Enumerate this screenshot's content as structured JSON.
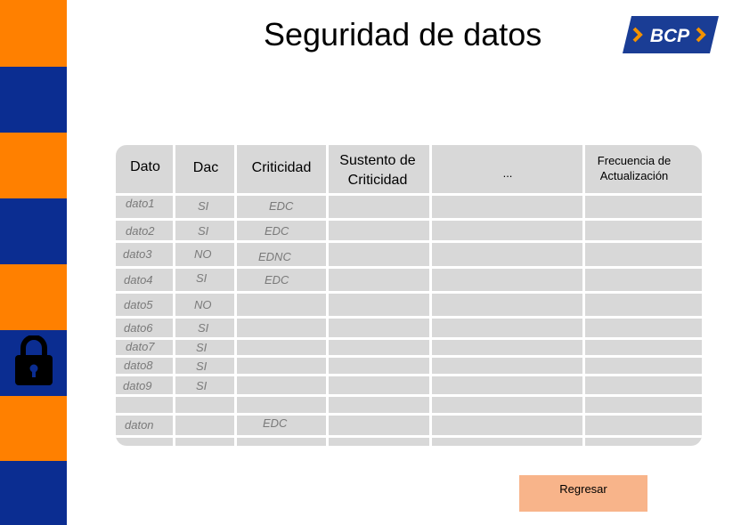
{
  "page": {
    "title": "Seguridad de datos"
  },
  "logo": {
    "text": "BCP",
    "colors": {
      "background": "#1a3d95",
      "accent": "#f39200"
    }
  },
  "sidebar": {
    "colors": {
      "orange": "#ff8000",
      "blue": "#0b2d91"
    },
    "icon": "lock-icon"
  },
  "table": {
    "headers": [
      "Dato",
      "Dac",
      "Criticidad",
      "Sustento de Criticidad",
      "...",
      "Frecuencia de Actualización"
    ],
    "rows": [
      {
        "dato": "dato1",
        "dac": "SI",
        "criticidad": "EDC"
      },
      {
        "dato": "dato2",
        "dac": "SI",
        "criticidad": "EDC"
      },
      {
        "dato": "dato3",
        "dac": "NO",
        "criticidad": "EDNC"
      },
      {
        "dato": "dato4",
        "dac": "SI",
        "criticidad": "EDC"
      },
      {
        "dato": "dato5",
        "dac": "NO",
        "criticidad": ""
      },
      {
        "dato": "dato6",
        "dac": "SI",
        "criticidad": ""
      },
      {
        "dato": "dato7",
        "dac": "SI",
        "criticidad": ""
      },
      {
        "dato": "dato8",
        "dac": "SI",
        "criticidad": ""
      },
      {
        "dato": "dato9",
        "dac": "SI",
        "criticidad": ""
      },
      {
        "dato": "",
        "dac": "",
        "criticidad": ""
      },
      {
        "dato": "daton",
        "dac": "",
        "criticidad": "EDC"
      },
      {
        "dato": "",
        "dac": "",
        "criticidad": ""
      }
    ]
  },
  "button": {
    "label": "Regresar"
  }
}
